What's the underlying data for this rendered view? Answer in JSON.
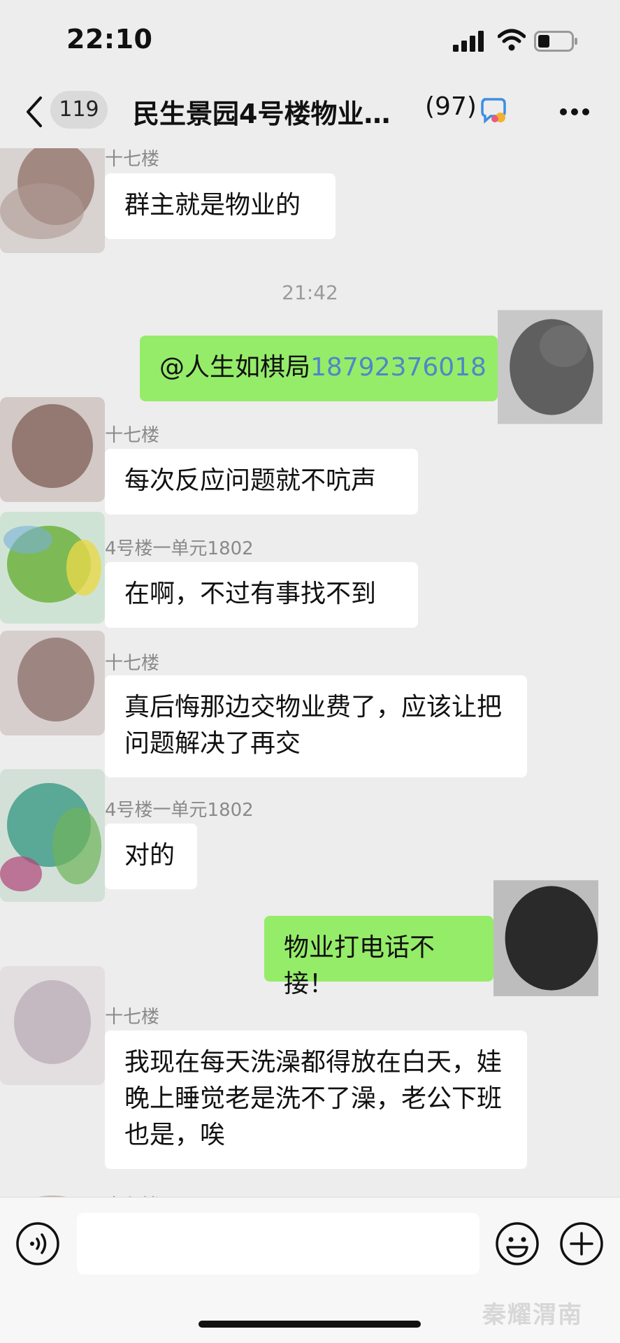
{
  "status_bar": {
    "time": "22:10"
  },
  "header": {
    "unread_count": "119",
    "title": "民生景园4号楼物业…",
    "member_count": "(97)"
  },
  "messages": [
    {
      "sender": "十七楼",
      "text": "群主就是物业的",
      "direction": "incoming"
    },
    {
      "timestamp": "21:42"
    },
    {
      "text_prefix": "@人生如棋局",
      "text_number": "18792376018",
      "direction": "outgoing"
    },
    {
      "sender": "十七楼",
      "text": "每次反应问题就不吭声",
      "direction": "incoming"
    },
    {
      "sender": "4号楼一单元1802",
      "text": "在啊，不过有事找不到",
      "direction": "incoming"
    },
    {
      "sender": "十七楼",
      "text": "真后悔那边交物业费了，应该让把问题解决了再交",
      "direction": "incoming"
    },
    {
      "sender": "4号楼一单元1802",
      "text": "对的",
      "direction": "incoming"
    },
    {
      "text": "物业打电话不接！",
      "direction": "outgoing"
    },
    {
      "sender": "十七楼",
      "text": "我现在每天洗澡都得放在白天，娃晚上睡觉老是洗不了澡，老公下班也是，唉",
      "direction": "incoming"
    },
    {
      "sender": "十七楼",
      "direction": "incoming"
    }
  ],
  "input_bar": {
    "watermark": "秦耀渭南"
  },
  "colors": {
    "background": "#ededed",
    "incoming_bubble": "#ffffff",
    "outgoing_bubble": "#95ec69",
    "mention_link": "#4f86c8",
    "sender_name": "#8a8a8a"
  },
  "icons": [
    "back-arrow-icon",
    "signal-icon",
    "wifi-icon",
    "battery-icon",
    "group-chat-icon",
    "more-icon",
    "voice-icon",
    "emoji-icon",
    "plus-icon"
  ]
}
